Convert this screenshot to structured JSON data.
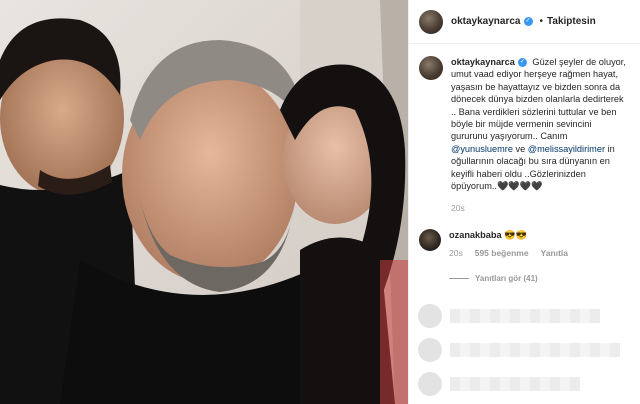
{
  "post": {
    "username": "oktaykaynarca",
    "follow_state": "Takiptesin",
    "caption_user": "oktaykaynarca",
    "caption_part1": "Güzel şeyler de oluyor, umut vaad ediyor herşeye rağmen hayat, yaşasın be hayattayız ve bizden sonra da dönecek dünya bizden olanlarla dedirterek .. Bana verdikleri sözlerini tuttular ve ben böyle bir müjde vermenin sevincini gururunu yaşıyorum.. Canım",
    "mention1": "@yunusluemre",
    "connector": "ve",
    "mention2": "@melissayildirimer",
    "caption_part2": "in oğullarının olacağı bu sıra dünyanın en keyifli haberi oldu ..Gözlerinizden öpüyorum..",
    "caption_emoji": "🖤🖤🖤🖤",
    "caption_time": "20s"
  },
  "comment": {
    "username": "ozanakbaba",
    "text": "😎😎",
    "time": "20s",
    "likes": "595 beğenme",
    "reply_label": "Yanıtla",
    "view_replies": "Yanıtları gör (41)"
  },
  "colors": {
    "verified": "#3897f0",
    "mention": "#003569",
    "muted": "#999999"
  },
  "icons": [
    "verified-badge-icon"
  ]
}
